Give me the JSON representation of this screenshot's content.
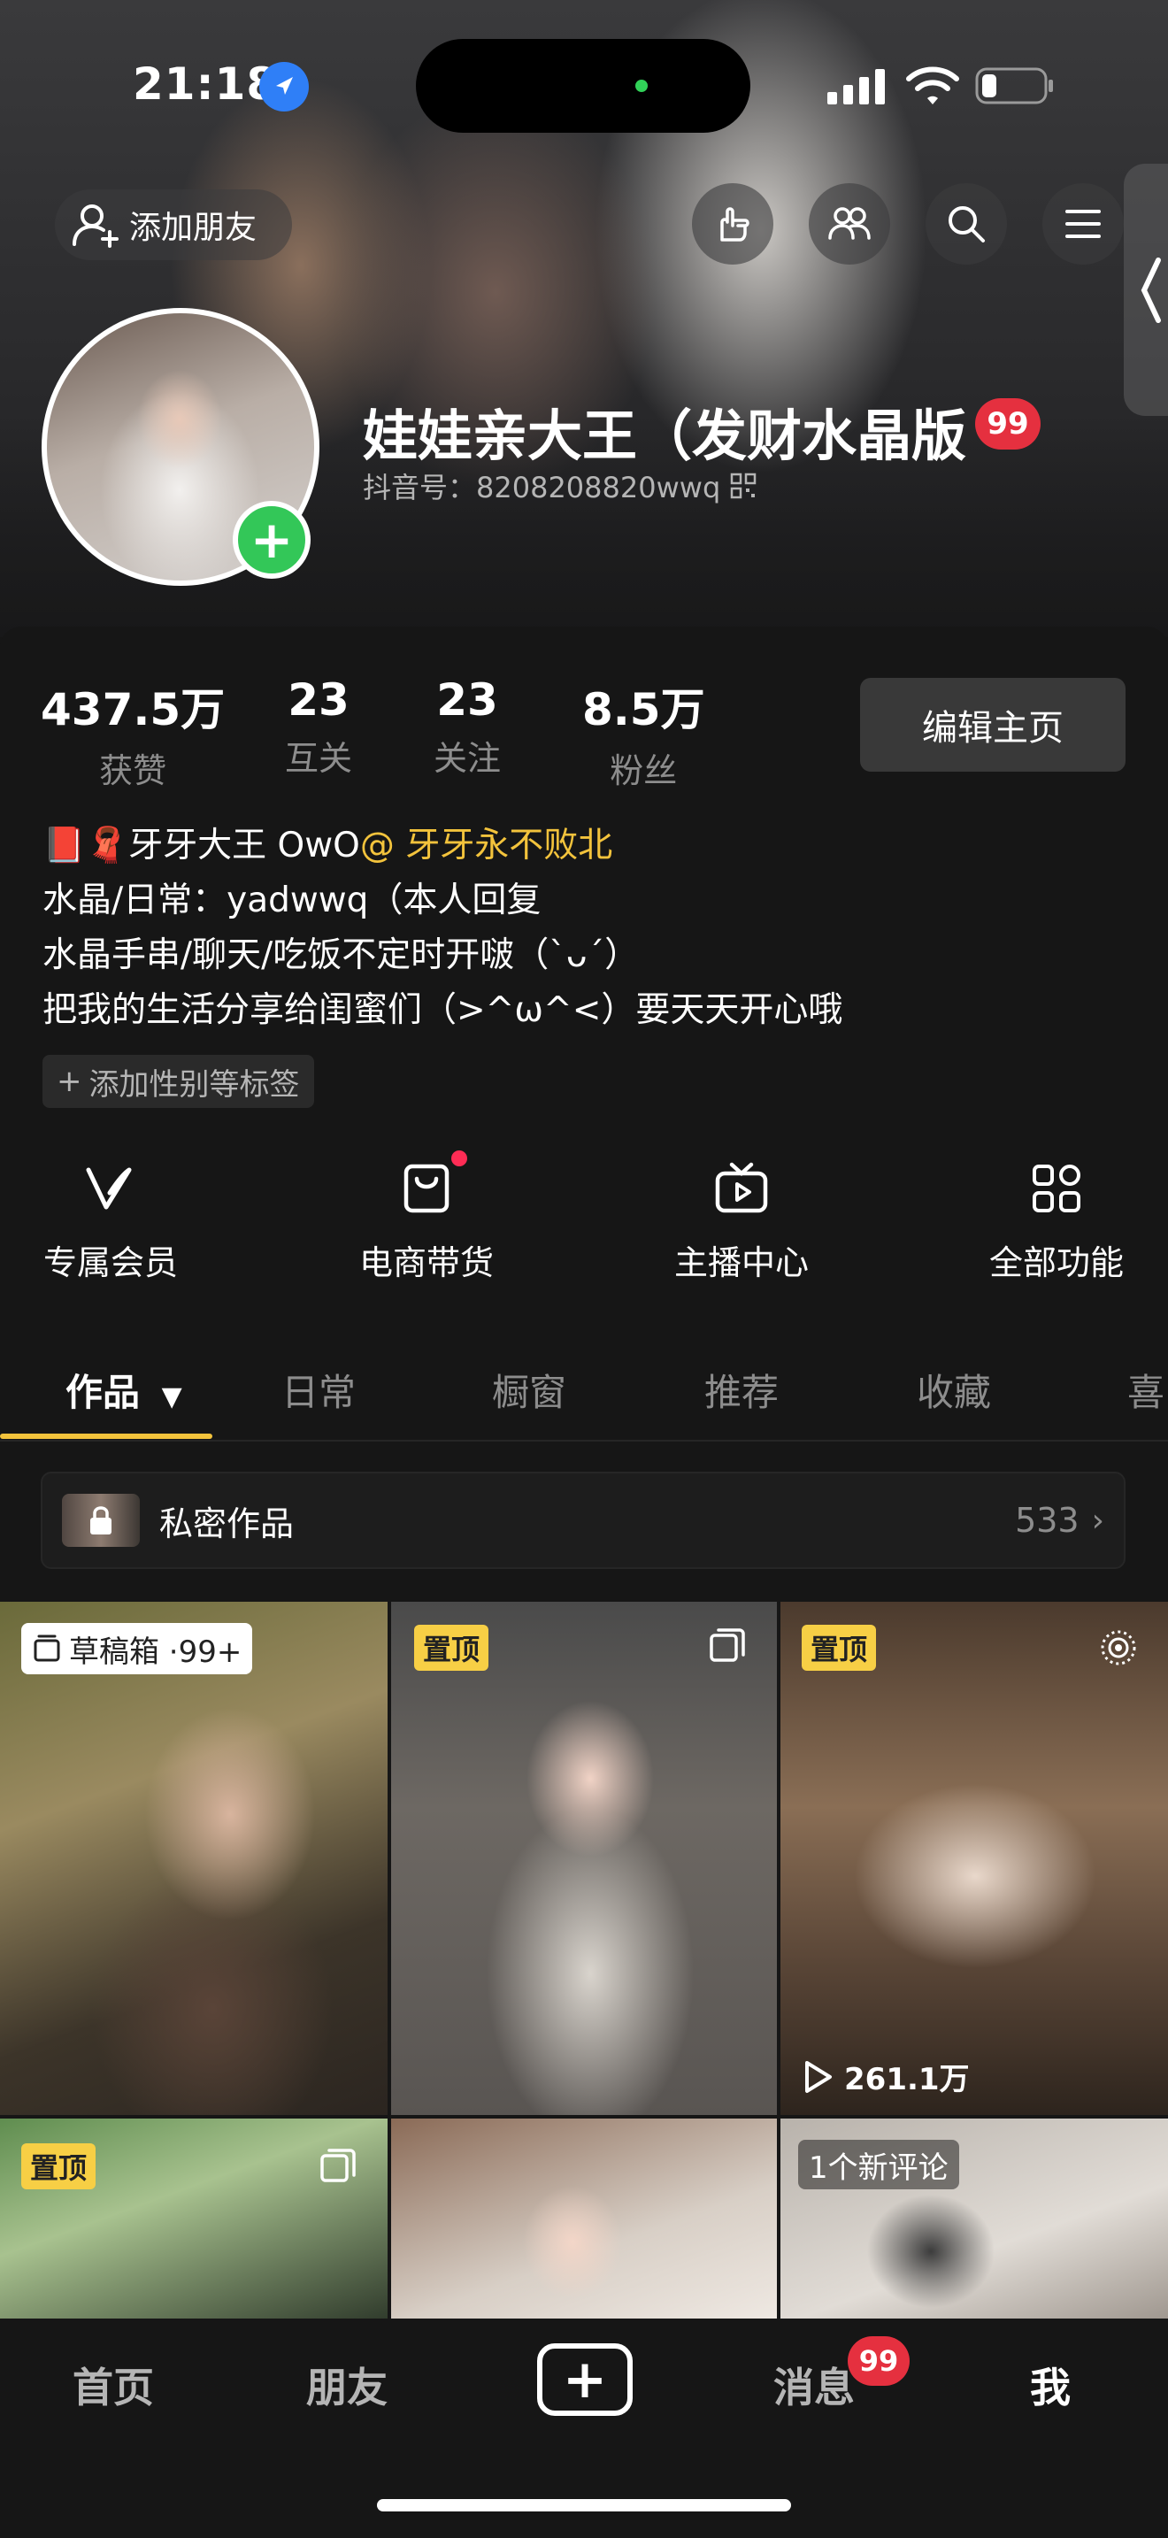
{
  "status_bar": {
    "time": "21:18"
  },
  "header": {
    "add_friend_label": "添加朋友",
    "name": "娃娃亲大王（发财水晶版",
    "name_badge": "99",
    "douyin_id": "抖音号：8208208820wwq"
  },
  "stats": [
    {
      "value": "437.5万",
      "label": "获赞"
    },
    {
      "value": "23",
      "label": "互关"
    },
    {
      "value": "23",
      "label": "关注"
    },
    {
      "value": "8.5万",
      "label": "粉丝"
    }
  ],
  "edit_button": "编辑主页",
  "bio": {
    "line1_prefix": "📕🧣牙牙大王 OwO",
    "line1_mention": "@ 牙牙永不败北",
    "line2": "水晶/日常：yadwwq（本人回复",
    "line3": "水晶手串/聊天/吃饭不定时开啵（`ᴗ´）",
    "line4": "把我的生活分享给闺蜜们（>^ω^<）要天天开心哦"
  },
  "tag_button": "添加性别等标签",
  "functions": [
    {
      "label": "专属会员",
      "icon": "vip-v-icon"
    },
    {
      "label": "电商带货",
      "icon": "shopping-bag-icon"
    },
    {
      "label": "主播中心",
      "icon": "tv-play-icon"
    },
    {
      "label": "全部功能",
      "icon": "grid-apps-icon"
    }
  ],
  "tabs": [
    "作品",
    "日常",
    "橱窗",
    "推荐",
    "收藏",
    "喜"
  ],
  "private_works": {
    "label": "私密作品",
    "count": "533"
  },
  "grid": {
    "draft_label": "草稿箱 ·99+",
    "pinned_label": "置顶",
    "views": "261.1万",
    "new_comment": "1个新评论"
  },
  "nav": {
    "home": "首页",
    "friends": "朋友",
    "messages": "消息",
    "messages_badge": "99",
    "me": "我"
  },
  "colors": {
    "accent": "#f3c33c",
    "badge_red": "#e5303f",
    "add_green": "#33c758",
    "background": "#161616"
  }
}
